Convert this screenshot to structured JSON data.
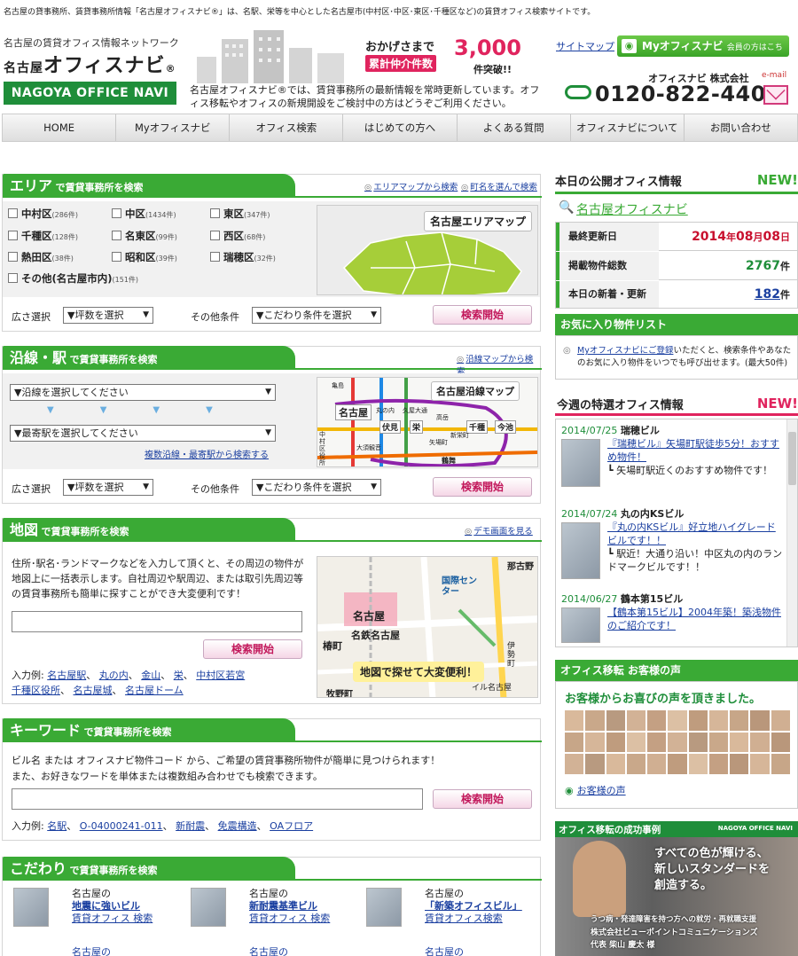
{
  "top_text": "名古屋の貸事務所、賃貸事務所情報「名古屋オフィスナビ®」は、名駅、栄等を中心とした名古屋市(中村区･中区･東区･千種区など)の賃貸オフィス検索サイトです。",
  "header": {
    "tagline": "名古屋の賃貸オフィス情報ネットワーク",
    "brand_a": "名古屋",
    "brand_b": "オフィスナビ",
    "brand_r": "®",
    "brand_en": "NAGOYA OFFICE NAVI",
    "stat1": "おかげさまで",
    "stat2": "累計仲介件数",
    "stat3": "3,000",
    "stat4": "件突破!!",
    "intro": "名古屋オフィスナビ®では、賃貸事務所の最新情報を常時更新しています。オフィス移転やオフィスの新規開設をご検討中の方はどうぞご利用ください。",
    "sitemap": "サイトマップ",
    "myoffice": "Myオフィスナビ",
    "myoffice_sub": "会員の方はこちら",
    "company": "オフィスナビ 株式会社",
    "email": "e-mail",
    "phone": "0120-822-440"
  },
  "nav": [
    "HOME",
    "Myオフィスナビ",
    "オフィス検索",
    "はじめての方へ",
    "よくある質問",
    "オフィスナビについて",
    "お問い合わせ"
  ],
  "area": {
    "title": "エリア",
    "sub": "で賃貸事務所を検索",
    "link1": "エリアマップから検索",
    "link2": "町名を選んで検索",
    "items": [
      {
        "n": "中村区",
        "c": "(286件)"
      },
      {
        "n": "中区",
        "c": "(1434件)"
      },
      {
        "n": "東区",
        "c": "(347件)"
      },
      {
        "n": "千種区",
        "c": "(128件)"
      },
      {
        "n": "名東区",
        "c": "(99件)"
      },
      {
        "n": "西区",
        "c": "(68件)"
      },
      {
        "n": "熱田区",
        "c": "(38件)"
      },
      {
        "n": "昭和区",
        "c": "(39件)"
      },
      {
        "n": "瑞穂区",
        "c": "(32件)"
      },
      {
        "n": "その他(名古屋市内)",
        "c": "(151件)"
      }
    ],
    "map_label": "名古屋エリアマップ",
    "size_label": "広さ選択",
    "size_value": "▼坪数を選択",
    "cond_label": "その他条件",
    "cond_value": "▼こだわり条件を選択",
    "search": "検索開始"
  },
  "line": {
    "title": "沿線・駅",
    "sub": "で賃貸事務所を検索",
    "link": "沿線マップから検索",
    "sel1": "▼沿線を選択してください",
    "sel2": "▼最寄駅を選択してください",
    "multi": "複数沿線・最寄駅から検索する",
    "map_label": "名古屋沿線マップ",
    "st_nagoya": "名古屋",
    "st_fushimi": "伏見",
    "st_sakae": "栄",
    "st_chikusa": "千種",
    "st_imaike": "今池",
    "st_a": "丸の内",
    "st_b": "久屋大通",
    "st_c": "高岳",
    "st_d": "矢場町",
    "st_e": "新栄町",
    "st_f": "大須観音",
    "st_g": "鶴舞",
    "st_h": "亀島",
    "st_i": "中村区役所",
    "size_label": "広さ選択",
    "size_value": "▼坪数を選択",
    "cond_label": "その他条件",
    "cond_value": "▼こだわり条件を選択",
    "search": "検索開始"
  },
  "map": {
    "title": "地図",
    "sub": "で賃貸事務所を検索",
    "link": "デモ画面を見る",
    "desc": "住所･駅名･ランドマークなどを入力して頂くと、その周辺の物件が地図上に一括表示します。自社周辺や駅周辺、または取引先周辺等の賃貸事務所も簡単に探すことができ大変便利です！",
    "search": "検索開始",
    "ex_label": "入力例:",
    "examples": [
      "名古屋駅",
      "丸の内",
      "金山",
      "栄",
      "中村区若宮",
      "千種区役所",
      "名古屋城",
      "名古屋ドーム"
    ],
    "banner": "地図で探せて大変便利！",
    "m1": "那古野",
    "m2": "国際センター",
    "m3": "名古屋",
    "m4": "名鉄名古屋",
    "m5": "椿町",
    "m6": "牧野町",
    "m7": "伊勢町",
    "m8": "イル名古屋"
  },
  "keyword": {
    "title": "キーワード",
    "sub": "で賃貸事務所を検索",
    "desc1": "ビル名 または オフィスナビ物件コード から、ご希望の賃貸事務所物件が簡単に見つけられます！",
    "desc2": "また、お好きなワードを単体または複数組み合わせでも検索できます。",
    "search": "検索開始",
    "ex_label": "入力例:",
    "examples": [
      "名駅",
      "O-04000241-011",
      "新耐震",
      "免震構造",
      "OAフロア"
    ]
  },
  "kodawari": {
    "title": "こだわり",
    "sub": "で賃貸事務所を検索",
    "items": [
      {
        "a": "名古屋の",
        "b": "地震に強いビル",
        "c": "賃貸オフィス 検索"
      },
      {
        "a": "名古屋の",
        "b": "新耐震基準ビル",
        "c": "賃貸オフィス 検索"
      },
      {
        "a": "名古屋の",
        "b": "「新築オフィスビル」",
        "c": "賃貸オフィス検索"
      }
    ],
    "more": [
      "名古屋の",
      "名古屋の",
      "名古屋の"
    ]
  },
  "today": {
    "title": "本日の公開オフィス情報",
    "new": "NEW!",
    "site": "名古屋オフィスナビ",
    "r1l": "最終更新日",
    "r1v_y": "2014",
    "r1v_m": "08",
    "r1v_d": "08",
    "r1u1": "年",
    "r1u2": "月",
    "r1u3": "日",
    "r2l": "掲載物件総数",
    "r2v": "2767",
    "r2u": "件",
    "r3l": "本日の新着・更新",
    "r3v": "182",
    "r3u": "件"
  },
  "fav": {
    "title": "お気に入り物件リスト",
    "link": "Myオフィスナビにご登録",
    "text": "いただくと、検索条件やあなたのお気に入り物件をいつでも呼び出せます。(最大50件)"
  },
  "weekly": {
    "title": "今週の特選オフィス情報",
    "new": "NEW!",
    "items": [
      {
        "date": "2014/07/25",
        "name": "瑞穂ビル",
        "title": "『瑞穂ビル』矢場町駅徒歩5分！おすすめ物件！",
        "desc": "┗ 矢場町駅近くのおすすめ物件です！"
      },
      {
        "date": "2014/07/24",
        "name": "丸の内KSビル",
        "title": "『丸の内KSビル』好立地ハイグレードビルです！！",
        "desc": "┗ 駅近！大通り沿い！中区丸の内のランドマークビルです！！"
      },
      {
        "date": "2014/06/27",
        "name": "鶴本第15ビル",
        "title": "【鶴本第15ビル】2004年築！築浅物件のご紹介です！",
        "desc": ""
      }
    ]
  },
  "voice": {
    "title": "オフィス移転 お客様の声",
    "headline": "お客様からお喜びの声を頂きました。",
    "link": "お客様の声"
  },
  "case": {
    "title": "オフィス移転の成功事例",
    "brand": "NAGOYA OFFICE NAVI",
    "c1": "すべての色が輝ける、",
    "c2": "新しいスタンダードを",
    "c3": "創造する。",
    "c4": "うつ病・発達障害を持つ方への就労・再就職支援",
    "c5": "株式会社ビューポイントコミュニケーションズ",
    "c6": "代表 柴山 慶太 様"
  },
  "colors": {
    "green": "#3aaa35",
    "pink": "#e0245e",
    "dark_green": "#1f8e3a"
  }
}
